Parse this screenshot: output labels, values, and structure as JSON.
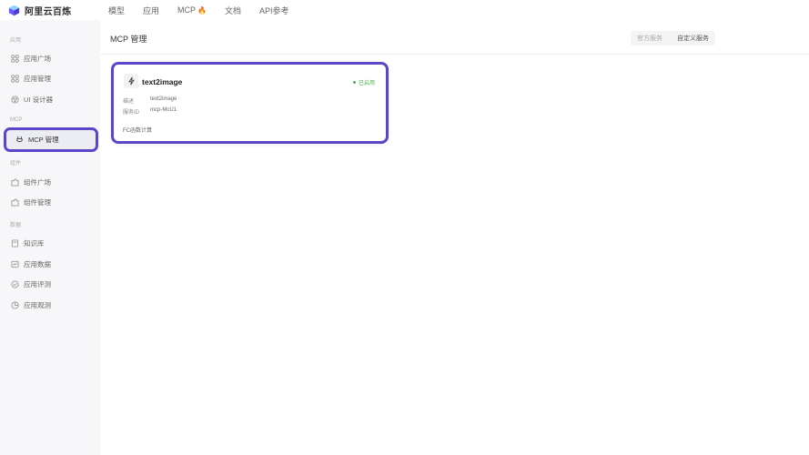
{
  "brand": {
    "name": "阿里云百炼"
  },
  "topnav": {
    "items": [
      {
        "label": "模型"
      },
      {
        "label": "应用"
      },
      {
        "label": "MCP"
      },
      {
        "label": "文档"
      },
      {
        "label": "API参考"
      }
    ]
  },
  "sidebar": {
    "sections": [
      "应用",
      "MCP",
      "组件",
      "数据"
    ],
    "items": [
      {
        "label": "应用广场"
      },
      {
        "label": "应用管理"
      },
      {
        "label": "UI 设计器"
      },
      {
        "label": "MCP 管理"
      },
      {
        "label": "组件广场"
      },
      {
        "label": "组件管理"
      },
      {
        "label": "知识库"
      },
      {
        "label": "应用数据"
      },
      {
        "label": "应用评测"
      },
      {
        "label": "应用观测"
      }
    ]
  },
  "page": {
    "title": "MCP 管理"
  },
  "service_tabs": [
    {
      "label": "官方服务"
    },
    {
      "label": "自定义服务"
    }
  ],
  "card": {
    "title": "text2image",
    "status": "已启用",
    "desc_key": "描述",
    "desc_value": "text2image",
    "id_key": "服务ID",
    "id_value": "mcp-McU1",
    "footer": "FC函数计算"
  },
  "colors": {
    "accent": "#5b45c9",
    "status": "#4caf50"
  }
}
